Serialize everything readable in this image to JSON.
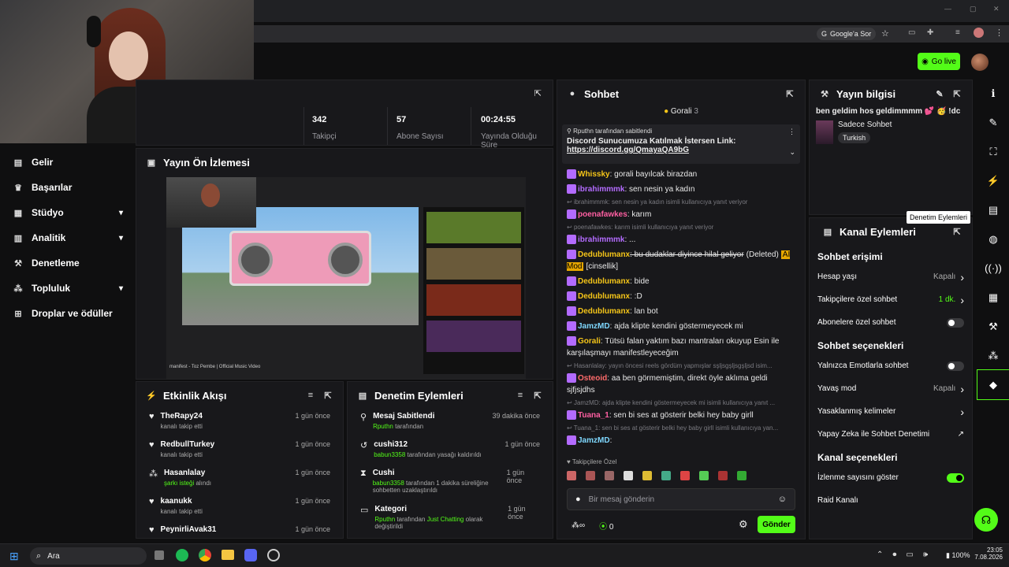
{
  "browser": {
    "search_label": "Google'a Sor"
  },
  "header": {
    "golive": "Go live"
  },
  "sidebar": {
    "items": [
      {
        "label": "Gelir",
        "chev": ""
      },
      {
        "label": "Başarılar",
        "chev": ""
      },
      {
        "label": "Stüdyo",
        "chev": "▾"
      },
      {
        "label": "Analitik",
        "chev": "▾"
      },
      {
        "label": "Denetleme",
        "chev": ""
      },
      {
        "label": "Topluluk",
        "chev": "▾"
      },
      {
        "label": "Droplar ve ödüller",
        "chev": ""
      }
    ]
  },
  "stats": [
    {
      "value": "342",
      "label": "Takipçi"
    },
    {
      "value": "57",
      "label": "Abone Sayısı"
    },
    {
      "value": "00:24:55",
      "label": "Yayında Olduğu Süre"
    }
  ],
  "preview": {
    "title": "Yayın Ön İzlemesi",
    "video_title": "manifest - Toz Pembe | Official Music Video"
  },
  "activity": {
    "title": "Etkinlik Akışı",
    "items": [
      {
        "name": "TheRapy24",
        "sub": "kanalı takip etti",
        "time": "1 gün önce"
      },
      {
        "name": "RedbullTurkey",
        "sub": "kanalı takip etti",
        "time": "1 gün önce"
      },
      {
        "name": "Hasanlalay",
        "sub_green": "şarkı isteği",
        "sub": " alındı",
        "time": "1 gün önce"
      },
      {
        "name": "kaanukk",
        "sub": "kanalı takip etti",
        "time": "1 gün önce"
      },
      {
        "name": "PeynirliAvak31",
        "sub": "",
        "time": "1 gün önce"
      }
    ]
  },
  "modactions": {
    "title": "Denetim Eylemleri",
    "items": [
      {
        "name": "Mesaj Sabitlendi",
        "user": "Rputhn",
        "rest": " tarafından",
        "time": "39 dakika önce"
      },
      {
        "name": "cushi312",
        "user": "babun3358",
        "rest": " tarafından yasağı kaldırıldı",
        "time": "1 gün önce"
      },
      {
        "name": "Cushi",
        "user": "babun3358",
        "rest": " tarafından 1 dakika süreliğine sohbetten uzaklaştırıldı",
        "time": "1 gün önce"
      },
      {
        "name": "Kategori",
        "user": "Rputhn",
        "rest": " tarafından ",
        "extra": "Just Chatting",
        "rest2": " olarak değiştirildi",
        "time": "1 gün önce"
      }
    ]
  },
  "chat": {
    "title": "Sohbet",
    "top_user": "Gorali",
    "top_count": "3",
    "pinned_by": "Rputhn tarafından sabitlendi",
    "pinned_text": "Discord Sunucumuza Katılmak İstersen Link:",
    "pinned_link": "https://discord.gg/QmayaQA9bG",
    "messages": [
      {
        "type": "msg",
        "user": "Whissky",
        "color": "#f5c518",
        "text": ": gorali bayılcak birazdan"
      },
      {
        "type": "msg",
        "user": "ibrahimmmk",
        "color": "#b36bff",
        "text": ": sen nesin ya kadın"
      },
      {
        "type": "reply",
        "text": "ibrahimmmk: sen nesin ya kadın isimli kullanıcıya yanıt veriyor"
      },
      {
        "type": "msg",
        "user": "poenafawkes",
        "color": "#ff5fa2",
        "text": ": karım"
      },
      {
        "type": "reply",
        "text": "poenafawkes: karım isimli kullanıcıya yanıt veriyor"
      },
      {
        "type": "msg",
        "user": "ibrahimmmk",
        "color": "#b36bff",
        "text": ": ..."
      },
      {
        "type": "msg",
        "user": "Dedublumanx",
        "color": "#f5c518",
        "text": ": bu dudaklar diyince hilal geliyor",
        "tag": "(Deleted)",
        "mod": "AI Mod",
        "tail": "[cinsellik]"
      },
      {
        "type": "msg",
        "user": "Dedublumanx",
        "color": "#f5c518",
        "text": ": bide"
      },
      {
        "type": "msg",
        "user": "Dedublumanx",
        "color": "#f5c518",
        "text": ": :D"
      },
      {
        "type": "msg",
        "user": "Dedublumanx",
        "color": "#f5c518",
        "text": ": lan bot"
      },
      {
        "type": "msg",
        "user": "JamzMD",
        "color": "#7fd8ff",
        "text": ": ajda klipte kendini göstermeyecek mi"
      },
      {
        "type": "msg",
        "user": "Gorali",
        "color": "#f5c518",
        "text": ": Tütsü falan yaktım bazı mantraları okuyup Esin ile karşılaşmayı manifestleyeceğim"
      },
      {
        "type": "reply",
        "text": "Hasanlalay: yayın öncesi reels gördüm yapmışlar sşljsgşljsgşljsd isim..."
      },
      {
        "type": "msg",
        "user": "Osteoid",
        "color": "#ff6b6b",
        "text": ": aa ben görmemiştim, direkt öyle aklıma geldi sjfjsjdhs"
      },
      {
        "type": "reply",
        "text": "JamzMD: ajda klipte kendini göstermeyecek mi isimli kullanıcıya yanıt ..."
      },
      {
        "type": "msg",
        "user": "Tuana_1",
        "color": "#ff5fa2",
        "text": ": sen bi ses at gösterir belki hey baby girll"
      },
      {
        "type": "reply",
        "text": "Tuana_1: sen bi ses at gösterir belki hey baby girll isimli kullanıcıya yan..."
      },
      {
        "type": "msg",
        "user": "JamzMD",
        "color": "#7fd8ff",
        "text": ":"
      }
    ],
    "follower_label": "Takipçilere Özel",
    "input_placeholder": "Bir mesaj gönderin",
    "points": "0",
    "send": "Gönder"
  },
  "info": {
    "title": "Yayın bilgisi",
    "stream_title": "ben geldim hos geldimmmm 💕 🥳 !dc",
    "mode": "Sadece Sohbet",
    "language": "Turkish"
  },
  "channel": {
    "title": "Kanal Eylemleri",
    "tooltip": "Denetim Eylemleri",
    "sections": [
      {
        "heading": "Sohbet erişimi",
        "rows": [
          {
            "label": "Hesap yaşı",
            "value": "Kapalı",
            "kind": "arrow"
          },
          {
            "label": "Takipçilere özel sohbet",
            "value": "1 dk.",
            "kind": "arrow",
            "green": true
          },
          {
            "label": "Abonelere özel sohbet",
            "kind": "toggle",
            "on": false
          }
        ]
      },
      {
        "heading": "Sohbet seçenekleri",
        "rows": [
          {
            "label": "Yalnızca Emotlarla sohbet",
            "kind": "toggle",
            "on": false
          },
          {
            "label": "Yavaş mod",
            "value": "Kapalı",
            "kind": "arrow"
          },
          {
            "label": "Yasaklanmış kelimeler",
            "kind": "arrow"
          },
          {
            "label": "Yapay Zeka ile Sohbet Denetimi",
            "kind": "ext"
          }
        ]
      },
      {
        "heading": "Kanal seçenekleri",
        "rows": [
          {
            "label": "İzlenme sayısını göster",
            "kind": "toggle",
            "on": true
          },
          {
            "label": "Raid Kanalı",
            "kind": "none"
          }
        ]
      }
    ]
  },
  "taskbar": {
    "search": "Ara",
    "battery": "100%",
    "time": "23:05",
    "date": "7.08.2026"
  }
}
